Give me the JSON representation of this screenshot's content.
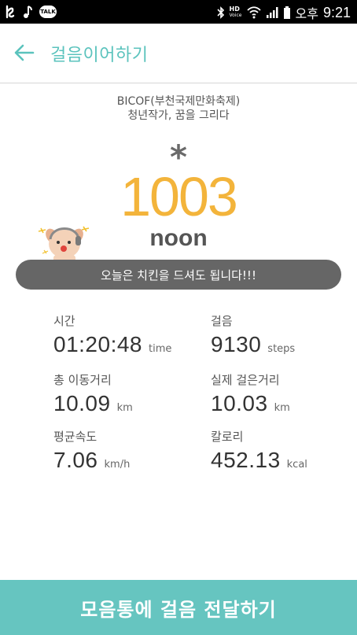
{
  "status_bar": {
    "talk_badge": "TALK",
    "hd": "HD",
    "volte": "Voice",
    "ampm": "오후",
    "time": "9:21",
    "icons": [
      "kakaostory-icon",
      "music-note-icon",
      "kakaotalk-icon",
      "bluetooth-icon",
      "wifi-icon",
      "signal-icon",
      "battery-icon"
    ]
  },
  "app_bar": {
    "back_icon": "arrow-left-icon",
    "title": "걸음이어하기"
  },
  "event": {
    "line1": "BICOF(부천국제만화축제)",
    "line2": "청년작가, 꿈을 그리다"
  },
  "participant": {
    "asterisk": "*",
    "number": "1003",
    "name": "noon"
  },
  "banner": {
    "message": "오늘은 치킨을 드셔도 됩니다!!!"
  },
  "stats": {
    "time": {
      "label": "시간",
      "value": "01:20:48",
      "unit": "time"
    },
    "steps": {
      "label": "걸음",
      "value": "9130",
      "unit": "steps"
    },
    "total_distance": {
      "label": "총 이동거리",
      "value": "10.09",
      "unit": "km"
    },
    "walked_distance": {
      "label": "실제 걸은거리",
      "value": "10.03",
      "unit": "km"
    },
    "avg_speed": {
      "label": "평균속도",
      "value": "7.06",
      "unit": "km/h"
    },
    "calories": {
      "label": "칼로리",
      "value": "452.13",
      "unit": "kcal"
    }
  },
  "bottom_button": {
    "label": "모음통에 걸음 전달하기"
  },
  "colors": {
    "accent": "#5bc3bd",
    "number": "#f3b43b",
    "banner": "#666666",
    "bottom_button": "#66c5c0"
  }
}
